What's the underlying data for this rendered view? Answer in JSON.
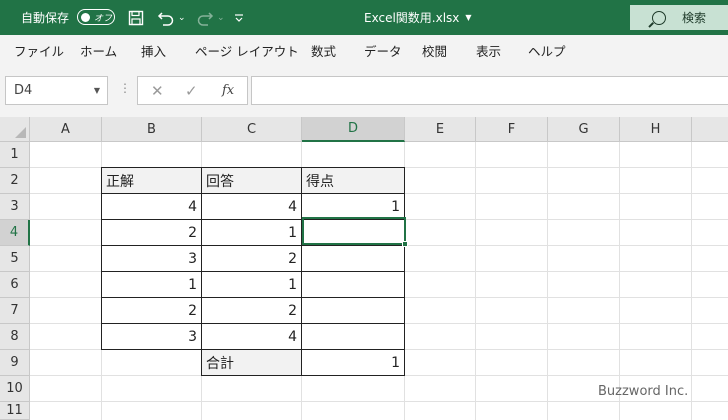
{
  "titlebar": {
    "autosave_label": "自動保存",
    "autosave_state": "オフ",
    "document_title": "Excel関数用.xlsx",
    "search_label": "検索"
  },
  "ribbon_tabs": [
    "ファイル",
    "ホーム",
    "挿入",
    "ページ レイアウト",
    "数式",
    "データ",
    "校閲",
    "表示",
    "ヘルプ"
  ],
  "formula_bar": {
    "name_box": "D4",
    "formula": ""
  },
  "columns": [
    "A",
    "B",
    "C",
    "D",
    "E",
    "F",
    "G",
    "H"
  ],
  "rows": [
    "1",
    "2",
    "3",
    "4",
    "5",
    "6",
    "7",
    "8",
    "9",
    "10",
    "11"
  ],
  "active_cell": "D4",
  "table": {
    "headers": [
      "正解",
      "回答",
      "得点"
    ],
    "rows": [
      [
        "4",
        "4",
        "1"
      ],
      [
        "2",
        "1",
        ""
      ],
      [
        "3",
        "2",
        ""
      ],
      [
        "1",
        "1",
        ""
      ],
      [
        "2",
        "2",
        ""
      ],
      [
        "3",
        "4",
        ""
      ]
    ],
    "total_label": "合計",
    "total_value": "1"
  },
  "watermark": "Buzzword Inc.",
  "colors": {
    "excel_green": "#217346",
    "ribbon_bg": "#f3f3f3",
    "header_bg": "#e6e6e6"
  }
}
